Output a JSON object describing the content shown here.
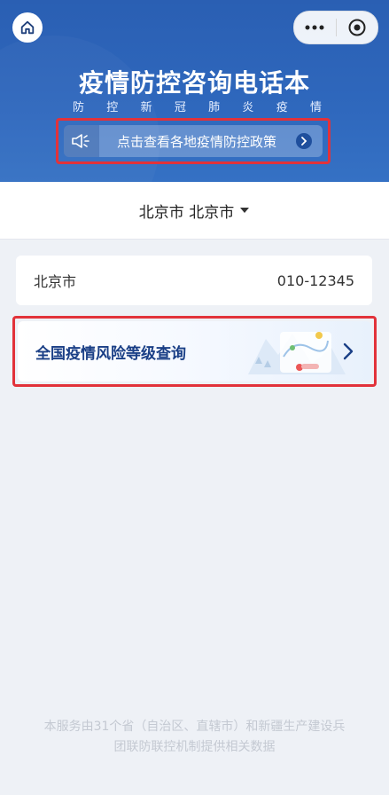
{
  "header": {
    "title": "疫情防控咨询电话本",
    "subtitle_chars": [
      "防",
      "控",
      "新",
      "冠",
      "肺",
      "炎",
      "疫",
      "情"
    ],
    "notice_text": "点击查看各地疫情防控政策"
  },
  "region": {
    "selected": "北京市 北京市"
  },
  "phone": {
    "city": "北京市",
    "number": "010-12345"
  },
  "risk": {
    "label": "全国疫情风险等级查询"
  },
  "footer": {
    "line1": "本服务由31个省（自治区、直辖市）和新疆生产建设兵",
    "line2": "团联防联控机制提供相关数据"
  },
  "colors": {
    "header_blue": "#2f68bd",
    "highlight_red": "#e2323a",
    "risk_text": "#1a3f86"
  },
  "icons": [
    "home-icon",
    "more-icon",
    "close-capsule-icon",
    "speaker-icon",
    "chevron-right-icon",
    "caret-down-icon"
  ]
}
